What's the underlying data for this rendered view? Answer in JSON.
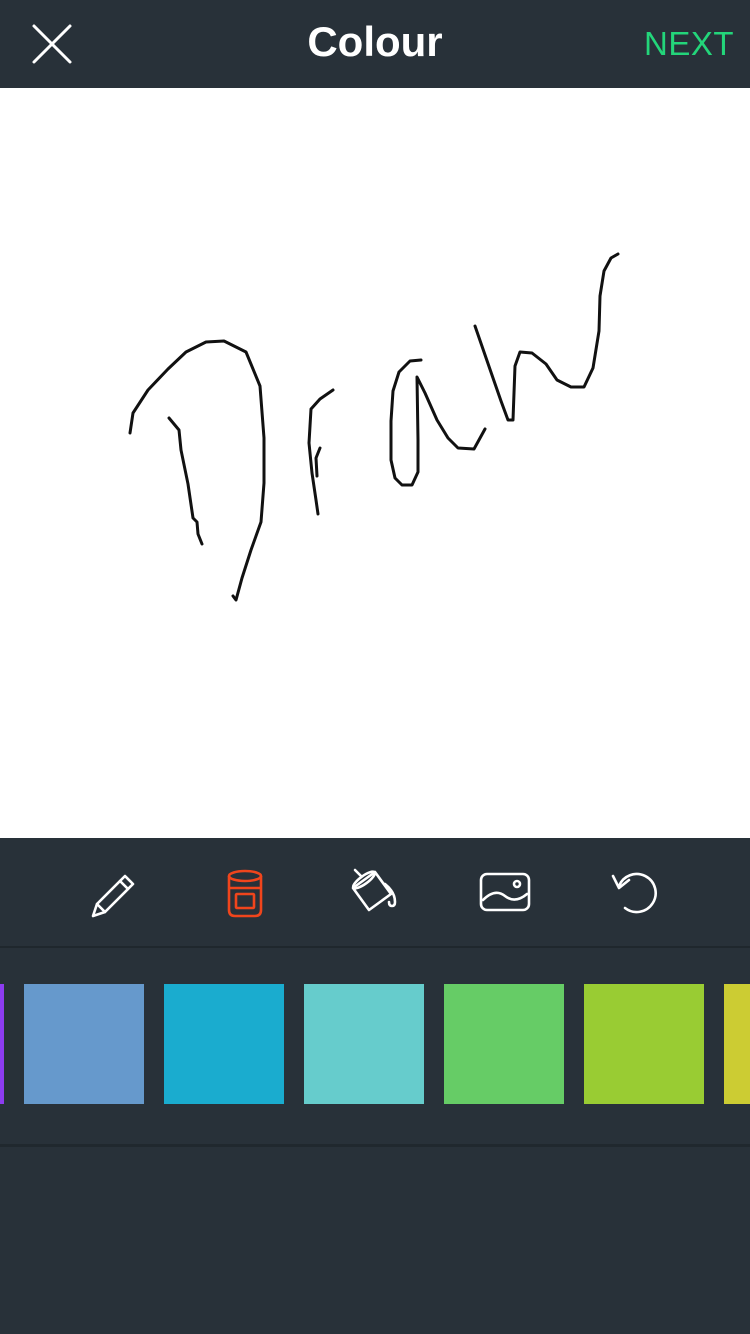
{
  "header": {
    "title": "Colour",
    "next_label": "NEXT",
    "close_icon": "close-icon"
  },
  "toolbar": {
    "tools": [
      {
        "name": "pencil-tool",
        "icon": "pencil-icon",
        "active": false
      },
      {
        "name": "bucket-tool",
        "icon": "paint-bucket-icon",
        "active": true
      },
      {
        "name": "fill-tool",
        "icon": "paint-pour-icon",
        "active": false
      },
      {
        "name": "image-tool",
        "icon": "image-icon",
        "active": false
      },
      {
        "name": "undo-tool",
        "icon": "undo-icon",
        "active": false
      }
    ],
    "active_color": "#f0451c",
    "inactive_color": "#ffffff"
  },
  "palette": {
    "colors": [
      "#8d3cf0",
      "#6699cc",
      "#1aaccf",
      "#66cccc",
      "#66cc66",
      "#99cc33",
      "#cccc33"
    ]
  },
  "colors": {
    "bar_background": "#283139",
    "accent_next": "#23d57a",
    "canvas_background": "#ffffff",
    "stroke": "#111111"
  }
}
